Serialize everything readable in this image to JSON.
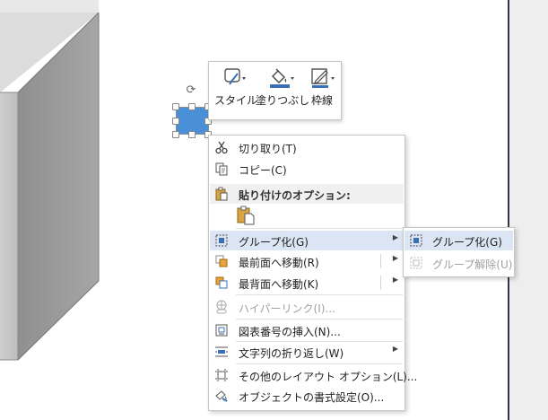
{
  "mini_toolbar": {
    "style_label": "スタイル",
    "fill_label": "塗りつぶし",
    "outline_label": "枠線"
  },
  "context_menu": {
    "cut": "切り取り(T)",
    "copy": "コピー(C)",
    "paste_options_header": "貼り付けのオプション:",
    "group": "グループ化(G)",
    "bring_to_front": "最前面へ移動(R)",
    "send_to_back": "最背面へ移動(K)",
    "hyperlink": "ハイパーリンク(I)...",
    "insert_caption": "図表番号の挿入(N)...",
    "wrap_text": "文字列の折り返し(W)",
    "more_layout_options": "その他のレイアウト オプション(L)...",
    "format_object": "オブジェクトの書式設定(O)..."
  },
  "submenu": {
    "group": "グループ化(G)",
    "ungroup": "グループ解除(U)"
  },
  "colors": {
    "menu_hover": "#dbe5f4",
    "shape_fill": "#4a90d9",
    "disabled_text": "#a0a0a0"
  }
}
